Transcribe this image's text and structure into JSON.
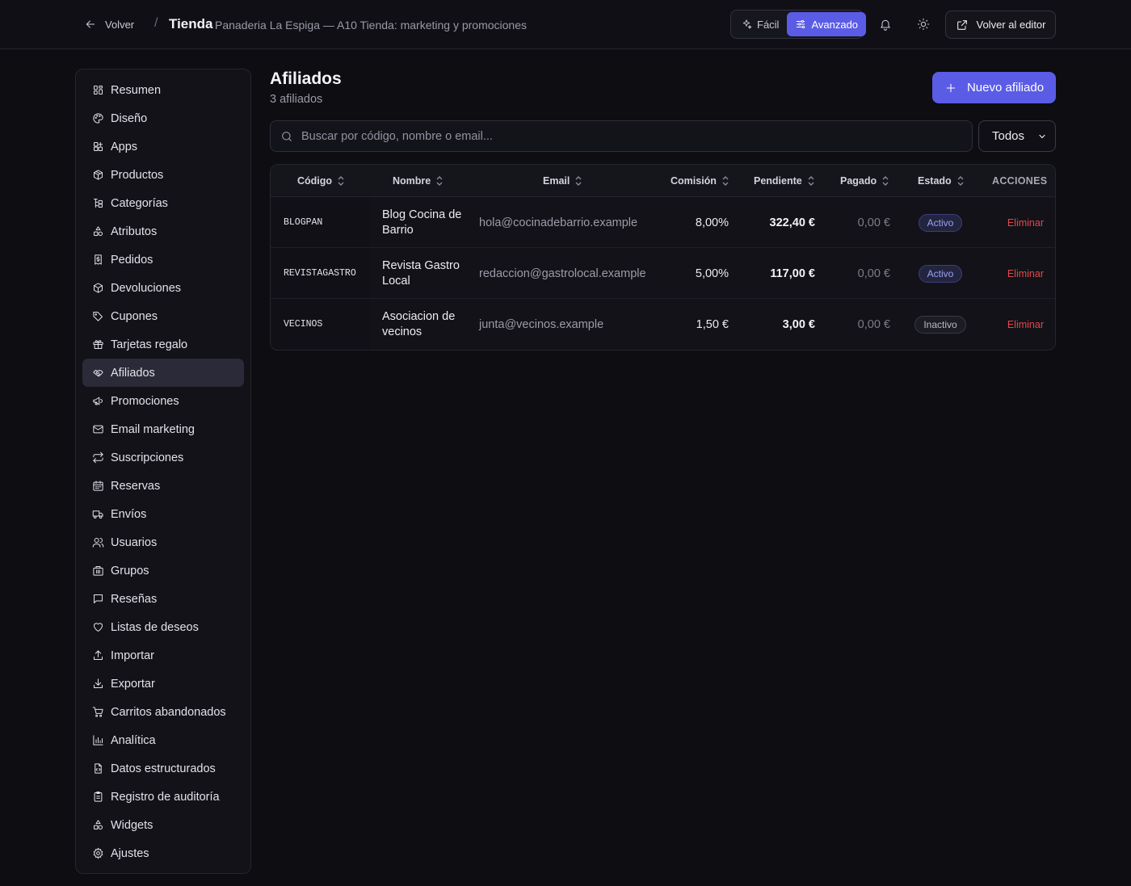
{
  "header": {
    "back_label": "Volver",
    "separator": "/",
    "title": "Tienda",
    "subtitle": "Panaderia La Espiga — A10 Tienda: marketing y promociones",
    "mode_easy": "Fácil",
    "mode_advanced": "Avanzado",
    "mode_selected": "Avanzado",
    "editor_label": "Volver al editor"
  },
  "sidebar": {
    "active": "Afiliados",
    "items": [
      {
        "label": "Resumen",
        "icon": "grid-icon"
      },
      {
        "label": "Diseño",
        "icon": "palette-icon"
      },
      {
        "label": "Apps",
        "icon": "apps-icon"
      },
      {
        "label": "Productos",
        "icon": "package-icon"
      },
      {
        "label": "Categorías",
        "icon": "tree-icon"
      },
      {
        "label": "Atributos",
        "icon": "shapes-icon"
      },
      {
        "label": "Pedidos",
        "icon": "receipt-icon"
      },
      {
        "label": "Devoluciones",
        "icon": "package-return-icon"
      },
      {
        "label": "Cupones",
        "icon": "tag-icon"
      },
      {
        "label": "Tarjetas regalo",
        "icon": "gift-icon"
      },
      {
        "label": "Afiliados",
        "icon": "handshake-icon"
      },
      {
        "label": "Promociones",
        "icon": "megaphone-icon"
      },
      {
        "label": "Email marketing",
        "icon": "mail-icon"
      },
      {
        "label": "Suscripciones",
        "icon": "repeat-icon"
      },
      {
        "label": "Reservas",
        "icon": "calendar-icon"
      },
      {
        "label": "Envíos",
        "icon": "truck-icon"
      },
      {
        "label": "Usuarios",
        "icon": "users-icon"
      },
      {
        "label": "Grupos",
        "icon": "building-icon"
      },
      {
        "label": "Reseñas",
        "icon": "message-icon"
      },
      {
        "label": "Listas de deseos",
        "icon": "heart-icon"
      },
      {
        "label": "Importar",
        "icon": "upload-icon"
      },
      {
        "label": "Exportar",
        "icon": "download-icon"
      },
      {
        "label": "Carritos abandonados",
        "icon": "cart-icon"
      },
      {
        "label": "Analítica",
        "icon": "bar-chart-icon"
      },
      {
        "label": "Datos estructurados",
        "icon": "file-code-icon"
      },
      {
        "label": "Registro de auditoría",
        "icon": "clipboard-icon"
      },
      {
        "label": "Widgets",
        "icon": "shapes-icon"
      },
      {
        "label": "Ajustes",
        "icon": "gear-icon"
      }
    ]
  },
  "main": {
    "title": "Afiliados",
    "count": "3 afiliados",
    "new_button": "Nuevo afiliado",
    "search_placeholder": "Buscar por código, nombre o email...",
    "search_value": "",
    "filter_value": "Todos",
    "filter_options": [
      "Todos"
    ]
  },
  "table": {
    "columns": [
      "Código",
      "Nombre",
      "Email",
      "Comisión",
      "Pendiente",
      "Pagado",
      "Estado",
      "ACCIONES"
    ],
    "rows": [
      {
        "code": "BLOGPAN",
        "name": "Blog Cocina de Barrio",
        "email": "hola@cocinadebarrio.example",
        "commission": "8,00%",
        "pending": "322,40 €",
        "paid": "0,00 €",
        "status": "Activo",
        "status_active": true,
        "action": "Eliminar"
      },
      {
        "code": "REVISTAGASTRO",
        "name": "Revista Gastro Local",
        "email": "redaccion@gastrolocal.example",
        "commission": "5,00%",
        "pending": "117,00 €",
        "paid": "0,00 €",
        "status": "Activo",
        "status_active": true,
        "action": "Eliminar"
      },
      {
        "code": "VECINOS",
        "name": "Asociacion de vecinos",
        "email": "junta@vecinos.example",
        "commission": "1,50 €",
        "pending": "3,00 €",
        "paid": "0,00 €",
        "status": "Inactivo",
        "status_active": false,
        "action": "Eliminar"
      }
    ]
  },
  "colors": {
    "accent": "#5b5ce6",
    "danger": "#e5484d",
    "background": "#0d0d12"
  }
}
